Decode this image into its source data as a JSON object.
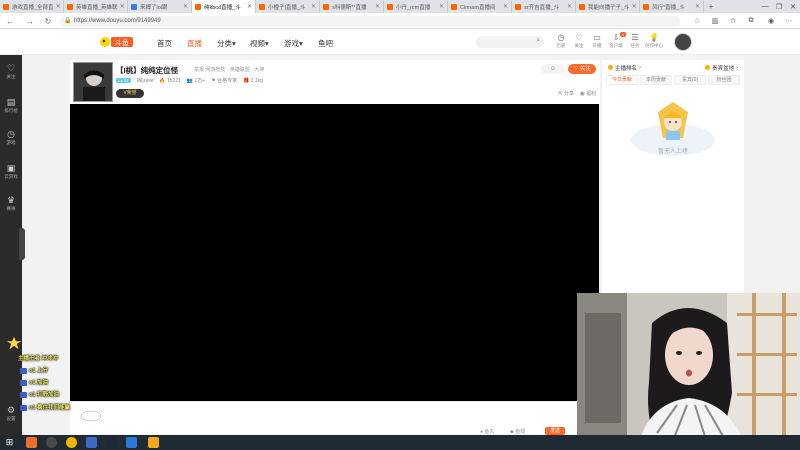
{
  "browser": {
    "tabs": [
      {
        "label": "游戏直播_全部直"
      },
      {
        "label": "英雄直播_英雄联"
      },
      {
        "label": "来搏了lol跟"
      },
      {
        "label": "纯kbcd直播_斗",
        "active": true
      },
      {
        "label": "小橙子|直播_斗"
      },
      {
        "label": "s科德斯**直播"
      },
      {
        "label": "小丹_rcm直播"
      },
      {
        "label": "Cinnam直播间"
      },
      {
        "label": "sr齐吉直播_斗"
      },
      {
        "label": "我能向播子子_斗"
      },
      {
        "label": "风行*直播_斗"
      }
    ],
    "new_tab_label": "+",
    "url": "https://www.douyu.com/9149949",
    "window_controls": [
      "—",
      "❐",
      "✕"
    ]
  },
  "site": {
    "logo_text": "斗鱼",
    "nav": [
      "首页",
      "直播",
      "分类",
      "视频",
      "游戏",
      "鱼吧"
    ],
    "nav_active_index": 1,
    "header_items": [
      "历史",
      "关注",
      "开播",
      "客户端",
      "任务",
      "创作中心"
    ],
    "header_badge": "4"
  },
  "sidebar": {
    "items": [
      {
        "icon": "♡",
        "label": "关注"
      },
      {
        "icon": "▤",
        "label": "排行榜"
      },
      {
        "icon": "◷",
        "label": "游戏"
      },
      {
        "icon": "▣",
        "label": "云游戏"
      },
      {
        "icon": "♛",
        "label": "赛事"
      },
      {
        "icon": "⚙",
        "label": "设置"
      }
    ]
  },
  "room": {
    "title": "【I桃】纯纯定位怪",
    "title_extra": "举报  网游竞技 · 英雄联盟 · 大神",
    "level": "Lv.32",
    "streamer_name": "I桃zelie",
    "popularity": "15221",
    "followers": "1万+",
    "room_tag": "合格专家",
    "gift_value": "3.1kg",
    "vip_label": "V荣誉",
    "fans_label": "☺",
    "follow_label": "关注",
    "actions": [
      "分享",
      "福利"
    ]
  },
  "rank": {
    "head_left": "主播排名",
    "head_right": "贵宾盆地",
    "tabs": [
      "今日贡献",
      "本周贡献",
      "贵宾(0)",
      "粉丝团"
    ],
    "empty_text": "暂无人上榜"
  },
  "player": {
    "bar_items": [
      "鱼丸",
      "鱼翅"
    ],
    "send_label": "发送"
  },
  "chat": {
    "lines": [
      "主播王者  冲冲冲",
      "o1 上分",
      "o1 加油",
      "o1 打野加油",
      "o1 稳住我们能赢"
    ]
  },
  "colors": {
    "accent": "#ff5d23",
    "sidebar_bg": "#2b2b2b",
    "taskbar_bg": "#1f2a33"
  }
}
